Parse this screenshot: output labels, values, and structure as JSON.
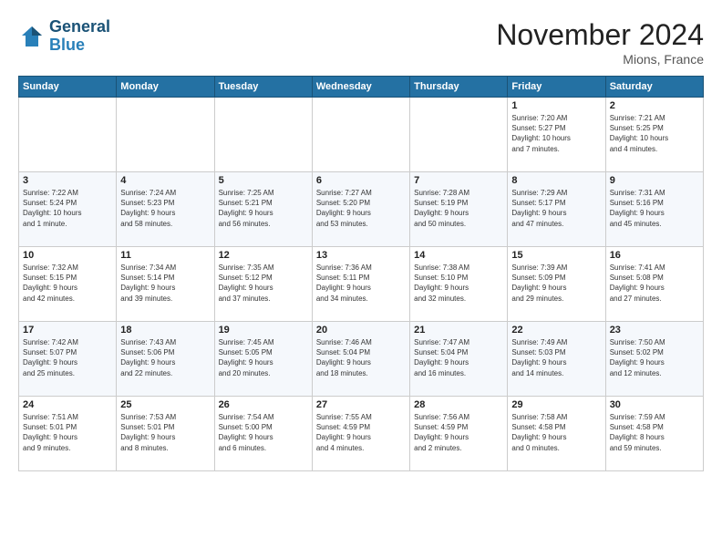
{
  "logo": {
    "general": "General",
    "blue": "Blue"
  },
  "header": {
    "month": "November 2024",
    "location": "Mions, France"
  },
  "days_of_week": [
    "Sunday",
    "Monday",
    "Tuesday",
    "Wednesday",
    "Thursday",
    "Friday",
    "Saturday"
  ],
  "weeks": [
    [
      {
        "num": "",
        "info": ""
      },
      {
        "num": "",
        "info": ""
      },
      {
        "num": "",
        "info": ""
      },
      {
        "num": "",
        "info": ""
      },
      {
        "num": "",
        "info": ""
      },
      {
        "num": "1",
        "info": "Sunrise: 7:20 AM\nSunset: 5:27 PM\nDaylight: 10 hours\nand 7 minutes."
      },
      {
        "num": "2",
        "info": "Sunrise: 7:21 AM\nSunset: 5:25 PM\nDaylight: 10 hours\nand 4 minutes."
      }
    ],
    [
      {
        "num": "3",
        "info": "Sunrise: 7:22 AM\nSunset: 5:24 PM\nDaylight: 10 hours\nand 1 minute."
      },
      {
        "num": "4",
        "info": "Sunrise: 7:24 AM\nSunset: 5:23 PM\nDaylight: 9 hours\nand 58 minutes."
      },
      {
        "num": "5",
        "info": "Sunrise: 7:25 AM\nSunset: 5:21 PM\nDaylight: 9 hours\nand 56 minutes."
      },
      {
        "num": "6",
        "info": "Sunrise: 7:27 AM\nSunset: 5:20 PM\nDaylight: 9 hours\nand 53 minutes."
      },
      {
        "num": "7",
        "info": "Sunrise: 7:28 AM\nSunset: 5:19 PM\nDaylight: 9 hours\nand 50 minutes."
      },
      {
        "num": "8",
        "info": "Sunrise: 7:29 AM\nSunset: 5:17 PM\nDaylight: 9 hours\nand 47 minutes."
      },
      {
        "num": "9",
        "info": "Sunrise: 7:31 AM\nSunset: 5:16 PM\nDaylight: 9 hours\nand 45 minutes."
      }
    ],
    [
      {
        "num": "10",
        "info": "Sunrise: 7:32 AM\nSunset: 5:15 PM\nDaylight: 9 hours\nand 42 minutes."
      },
      {
        "num": "11",
        "info": "Sunrise: 7:34 AM\nSunset: 5:14 PM\nDaylight: 9 hours\nand 39 minutes."
      },
      {
        "num": "12",
        "info": "Sunrise: 7:35 AM\nSunset: 5:12 PM\nDaylight: 9 hours\nand 37 minutes."
      },
      {
        "num": "13",
        "info": "Sunrise: 7:36 AM\nSunset: 5:11 PM\nDaylight: 9 hours\nand 34 minutes."
      },
      {
        "num": "14",
        "info": "Sunrise: 7:38 AM\nSunset: 5:10 PM\nDaylight: 9 hours\nand 32 minutes."
      },
      {
        "num": "15",
        "info": "Sunrise: 7:39 AM\nSunset: 5:09 PM\nDaylight: 9 hours\nand 29 minutes."
      },
      {
        "num": "16",
        "info": "Sunrise: 7:41 AM\nSunset: 5:08 PM\nDaylight: 9 hours\nand 27 minutes."
      }
    ],
    [
      {
        "num": "17",
        "info": "Sunrise: 7:42 AM\nSunset: 5:07 PM\nDaylight: 9 hours\nand 25 minutes."
      },
      {
        "num": "18",
        "info": "Sunrise: 7:43 AM\nSunset: 5:06 PM\nDaylight: 9 hours\nand 22 minutes."
      },
      {
        "num": "19",
        "info": "Sunrise: 7:45 AM\nSunset: 5:05 PM\nDaylight: 9 hours\nand 20 minutes."
      },
      {
        "num": "20",
        "info": "Sunrise: 7:46 AM\nSunset: 5:04 PM\nDaylight: 9 hours\nand 18 minutes."
      },
      {
        "num": "21",
        "info": "Sunrise: 7:47 AM\nSunset: 5:04 PM\nDaylight: 9 hours\nand 16 minutes."
      },
      {
        "num": "22",
        "info": "Sunrise: 7:49 AM\nSunset: 5:03 PM\nDaylight: 9 hours\nand 14 minutes."
      },
      {
        "num": "23",
        "info": "Sunrise: 7:50 AM\nSunset: 5:02 PM\nDaylight: 9 hours\nand 12 minutes."
      }
    ],
    [
      {
        "num": "24",
        "info": "Sunrise: 7:51 AM\nSunset: 5:01 PM\nDaylight: 9 hours\nand 9 minutes."
      },
      {
        "num": "25",
        "info": "Sunrise: 7:53 AM\nSunset: 5:01 PM\nDaylight: 9 hours\nand 8 minutes."
      },
      {
        "num": "26",
        "info": "Sunrise: 7:54 AM\nSunset: 5:00 PM\nDaylight: 9 hours\nand 6 minutes."
      },
      {
        "num": "27",
        "info": "Sunrise: 7:55 AM\nSunset: 4:59 PM\nDaylight: 9 hours\nand 4 minutes."
      },
      {
        "num": "28",
        "info": "Sunrise: 7:56 AM\nSunset: 4:59 PM\nDaylight: 9 hours\nand 2 minutes."
      },
      {
        "num": "29",
        "info": "Sunrise: 7:58 AM\nSunset: 4:58 PM\nDaylight: 9 hours\nand 0 minutes."
      },
      {
        "num": "30",
        "info": "Sunrise: 7:59 AM\nSunset: 4:58 PM\nDaylight: 8 hours\nand 59 minutes."
      }
    ]
  ]
}
